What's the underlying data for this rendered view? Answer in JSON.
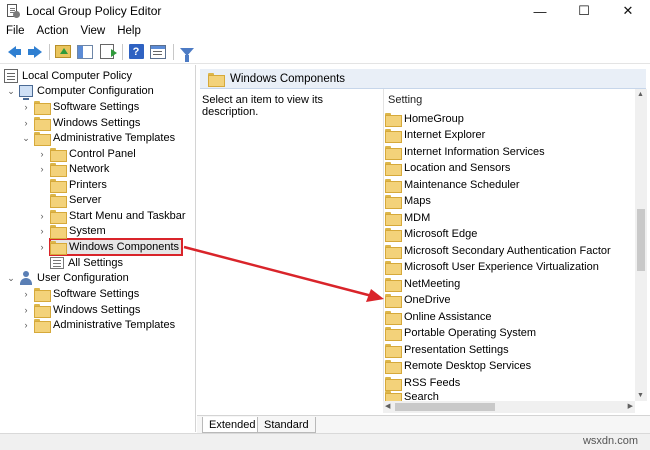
{
  "window": {
    "title": "Local Group Policy Editor",
    "minimize": "—",
    "maximize": "☐",
    "close": "✕"
  },
  "menu": [
    "File",
    "Action",
    "View",
    "Help"
  ],
  "toolbar": {
    "icons": [
      "back-arrow-icon",
      "forward-arrow-icon",
      "up-folder-icon",
      "show-hide-tree-icon",
      "export-list-icon",
      "help-icon",
      "properties-icon",
      "filter-icon"
    ]
  },
  "tree": {
    "root": "Local Computer Policy",
    "computer_config": "Computer Configuration",
    "cc_software": "Software Settings",
    "cc_windows": "Windows Settings",
    "cc_admin": "Administrative Templates",
    "at_control_panel": "Control Panel",
    "at_network": "Network",
    "at_printers": "Printers",
    "at_server": "Server",
    "at_start_menu": "Start Menu and Taskbar",
    "at_system": "System",
    "at_windows_components": "Windows Components",
    "at_all_settings": "All Settings",
    "user_config": "User Configuration",
    "uc_software": "Software Settings",
    "uc_windows": "Windows Settings",
    "uc_admin": "Administrative Templates"
  },
  "right": {
    "header": "Windows Components",
    "description": "Select an item to view its description.",
    "column": "Setting",
    "items": [
      "HomeGroup",
      "Internet Explorer",
      "Internet Information Services",
      "Location and Sensors",
      "Maintenance Scheduler",
      "Maps",
      "MDM",
      "Microsoft Edge",
      "Microsoft Secondary Authentication Factor",
      "Microsoft User Experience Virtualization",
      "NetMeeting",
      "OneDrive",
      "Online Assistance",
      "Portable Operating System",
      "Presentation Settings",
      "Remote Desktop Services",
      "RSS Feeds",
      "Search"
    ]
  },
  "tabs": {
    "extended": "Extended",
    "standard": "Standard"
  },
  "watermark": "wsxdn.com",
  "colors": {
    "annotation": "#d9242a",
    "folder": "#f3d27a",
    "header_band": "#e9eff7"
  }
}
